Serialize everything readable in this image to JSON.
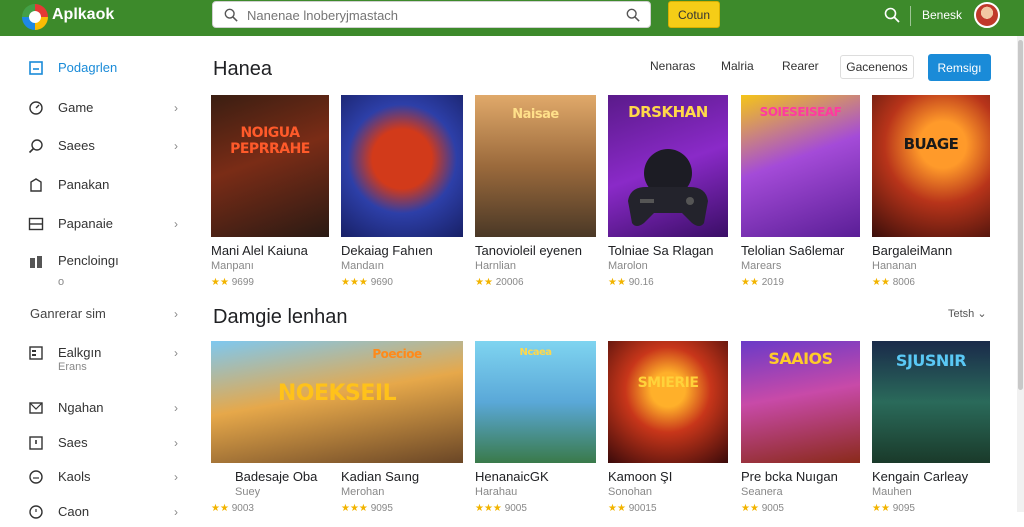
{
  "app": {
    "title": "Aplkaok"
  },
  "search": {
    "placeholder": "Nanenae lnoberyjmastach"
  },
  "header": {
    "action_button": "Cotun",
    "user_name": "Benesk"
  },
  "sidebar": {
    "items": [
      {
        "label": "Podagrlen",
        "icon": "home-icon",
        "active": true
      },
      {
        "label": "Game",
        "icon": "gamepad-icon",
        "chevron": true
      },
      {
        "label": "Saees",
        "icon": "search-icon",
        "chevron": true
      },
      {
        "label": "Panakan",
        "icon": "bookmark-icon"
      },
      {
        "label": "Papanaie",
        "icon": "grid-icon",
        "chevron": true
      },
      {
        "label": "Pencloingı",
        "icon": "chart-icon",
        "sub": "o"
      }
    ],
    "section": {
      "label": "Ganrerar sim"
    },
    "items2": [
      {
        "label": "Ealkgın",
        "icon": "calendar-icon",
        "sub": "Erans",
        "chevron": true
      },
      {
        "label": "Ngahan",
        "icon": "mail-icon",
        "chevron": true
      },
      {
        "label": "Saes",
        "icon": "info-icon",
        "chevron": true
      },
      {
        "label": "Kaols",
        "icon": "smile-icon",
        "chevron": true
      },
      {
        "label": "Caon",
        "icon": "clock-icon",
        "chevron": true
      }
    ]
  },
  "main": {
    "section1": {
      "title": "Hanea",
      "filters": [
        "Nenaras",
        "Malria",
        "Rearer"
      ],
      "chip": "Gacenenos",
      "button": "Remsigı"
    },
    "row1": [
      {
        "name": "Mani Alel Kaiuna",
        "sub": "Manpanı",
        "rating": "9699",
        "art": "NOIGUA PEPRRAHE"
      },
      {
        "name": "Dekaiag Fahıen",
        "sub": "Mandaın",
        "rating": "9690",
        "art": ""
      },
      {
        "name": "Tanovioleil eyenen",
        "sub": "Harnlian",
        "rating": "20006",
        "art": "Naisae"
      },
      {
        "name": "Tolniae Sa Rlagan",
        "sub": "Marolon",
        "rating": "90.16",
        "art": "DRSKHAN"
      },
      {
        "name": "Telolian Sa6lemar",
        "sub": "Marears",
        "rating": "2019",
        "art": "SOIESEISEAF"
      },
      {
        "name": "BargaleiMann",
        "sub": "Hananan",
        "rating": "8006",
        "art": "BUAGE"
      }
    ],
    "section2": {
      "title": "Damgie lenhan",
      "see_all": "Tetsh"
    },
    "row2": [
      {
        "name": "Badesaje Oba",
        "sub": "Suey",
        "rating": "9003",
        "art": "NOEKSEIL",
        "art2": "Poecioe"
      },
      {
        "name": "Kadian Saıng",
        "sub": "Merohan",
        "rating": "9095",
        "art": ""
      },
      {
        "name": "HenanaicGK",
        "sub": "Harahau",
        "rating": "9005",
        "art": "Ncaea"
      },
      {
        "name": "Kamoon ŞI",
        "sub": "Sonohan",
        "rating": "90015",
        "art": "SMIERIE"
      },
      {
        "name": "Pre bcka Nuıgan",
        "sub": "Seanera",
        "rating": "9005",
        "art": "SAAIOS"
      },
      {
        "name": "Kengain Carleay",
        "sub": "Mauhen",
        "rating": "9095",
        "art": "SJUSNIR"
      }
    ]
  },
  "colors": {
    "topbar": "#3d8a2b",
    "accent": "#1a8bd8",
    "button_yellow": "#f5cd17",
    "star": "#f2b400"
  }
}
